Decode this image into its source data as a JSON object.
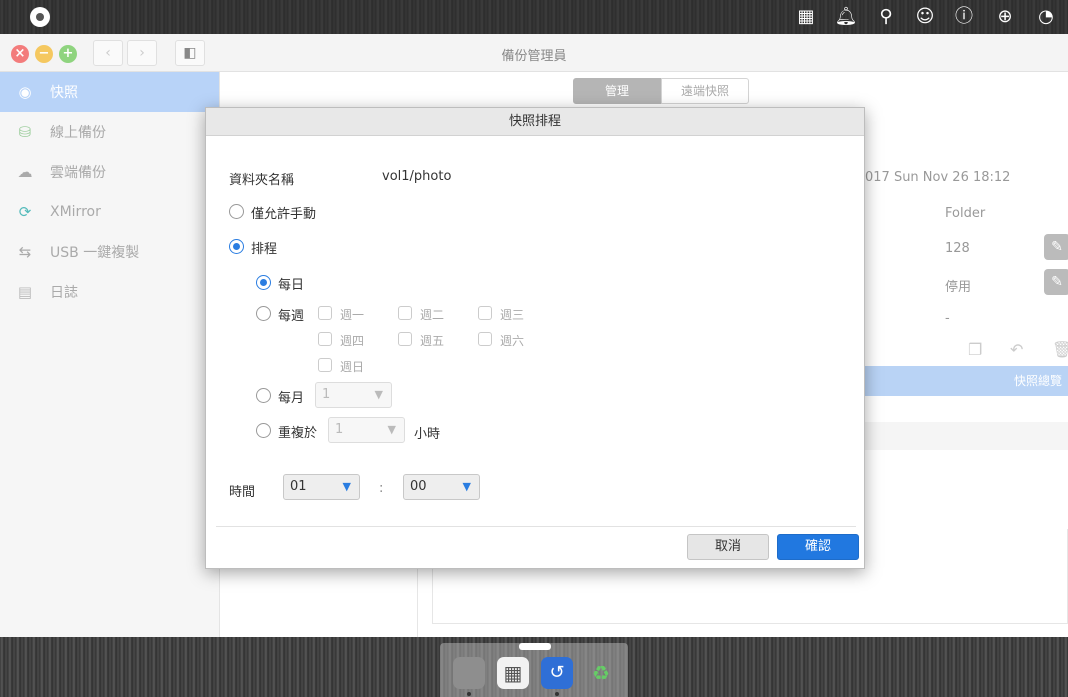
{
  "window": {
    "title": "備份管理員"
  },
  "sidebar": {
    "items": [
      {
        "label": "快照",
        "icon": "camera-icon",
        "active": true
      },
      {
        "label": "線上備份",
        "icon": "online-backup-icon"
      },
      {
        "label": "雲端備份",
        "icon": "cloud-backup-icon"
      },
      {
        "label": "XMirror",
        "icon": "mirror-icon"
      },
      {
        "label": "USB 一鍵複製",
        "icon": "usb-icon"
      },
      {
        "label": "日誌",
        "icon": "log-icon"
      }
    ]
  },
  "tabs": {
    "manage": "管理",
    "remote": "遠端快照"
  },
  "background": {
    "timestamp": "017 Sun Nov 26 18:12",
    "folder": "Folder",
    "count": "128",
    "status": "停用",
    "dash": "-",
    "bar_label": "快照總覽"
  },
  "dialog": {
    "title": "快照排程",
    "folder_label": "資料夾名稱",
    "folder_value": "vol1/photo",
    "manual_label": "僅允許手動",
    "schedule_label": "排程",
    "daily_label": "每日",
    "weekly_label": "每週",
    "days": [
      "週一",
      "週二",
      "週三",
      "週四",
      "週五",
      "週六",
      "週日"
    ],
    "monthly_label": "每月",
    "monthly_value": "1",
    "repeat_label": "重複於",
    "repeat_value": "1",
    "hours_label": "小時",
    "time_label": "時間",
    "hour_value": "01",
    "colon": ":",
    "minute_value": "00",
    "cancel": "取消",
    "confirm": "確認",
    "selected_mode": "schedule",
    "selected_frequency": "daily"
  }
}
